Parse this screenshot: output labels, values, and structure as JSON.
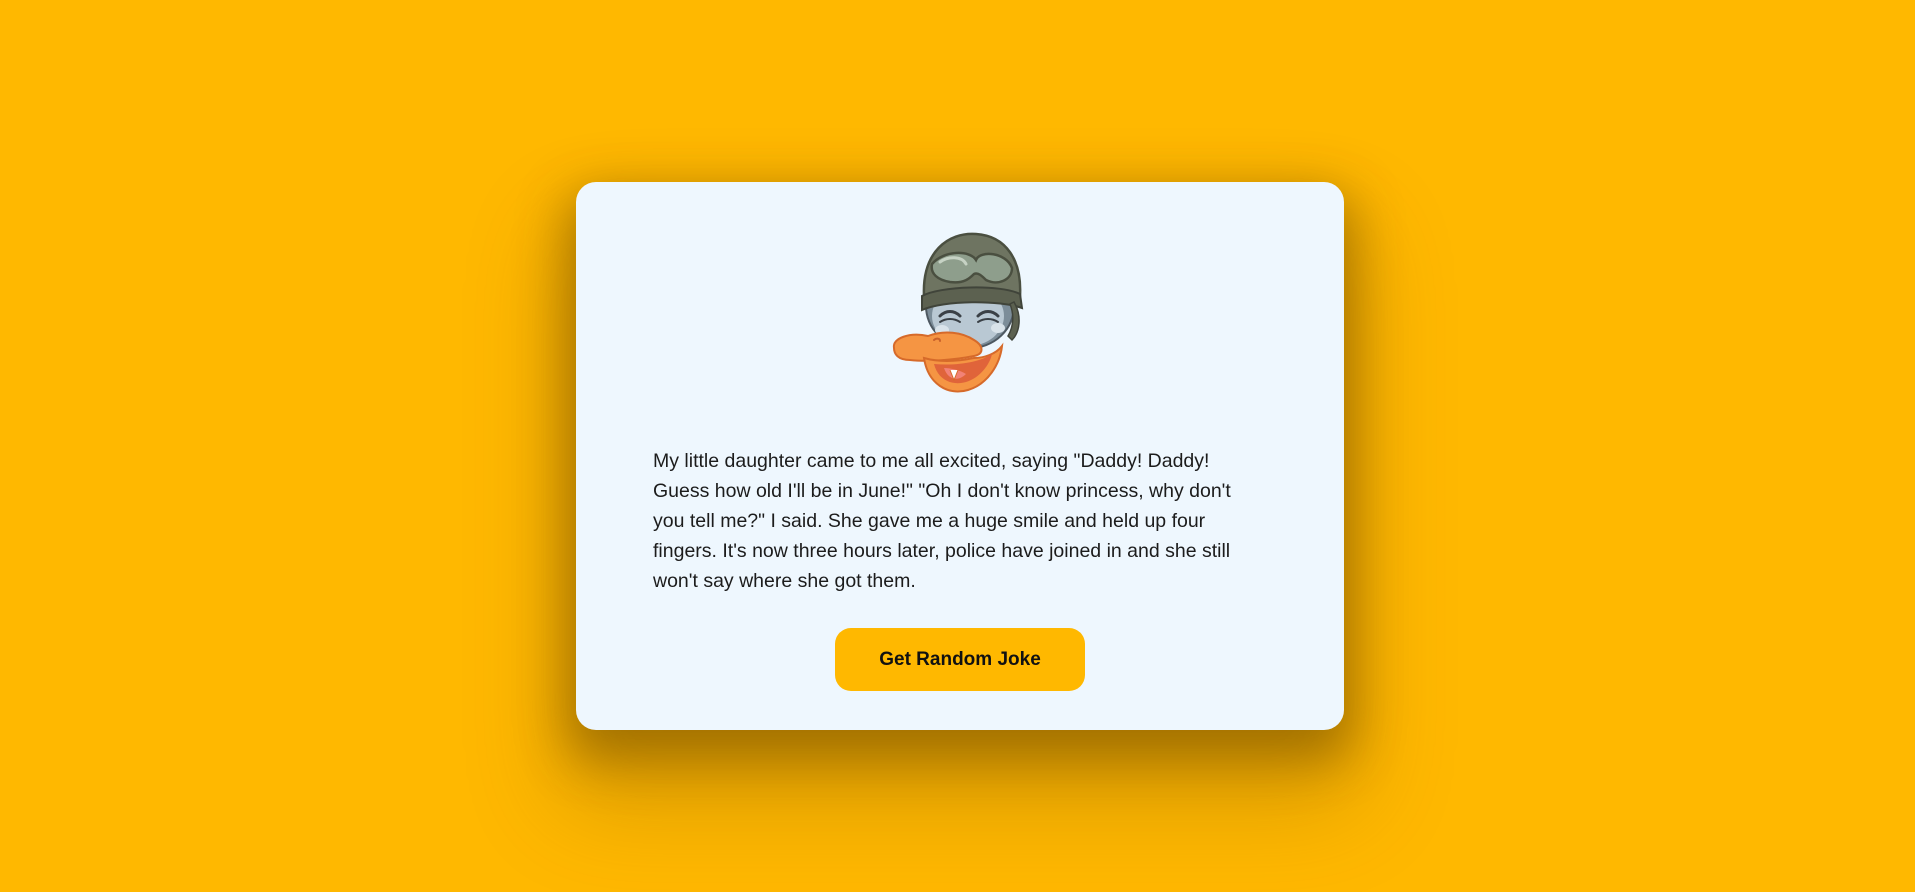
{
  "mascot": {
    "icon": "duck-soldier-icon"
  },
  "joke": {
    "text": "My little daughter came to me all excited, saying \"Daddy! Daddy! Guess how old I'll be in June!\" \"Oh I don't know princess, why don't you tell me?\" I said. She gave me a huge smile and held up four fingers. It's now three hours later, police have joined in and she still won't say where she got them."
  },
  "button": {
    "label": "Get Random Joke"
  },
  "colors": {
    "background": "#FFB800",
    "card": "#EEF7FE",
    "button": "#FFB800"
  }
}
